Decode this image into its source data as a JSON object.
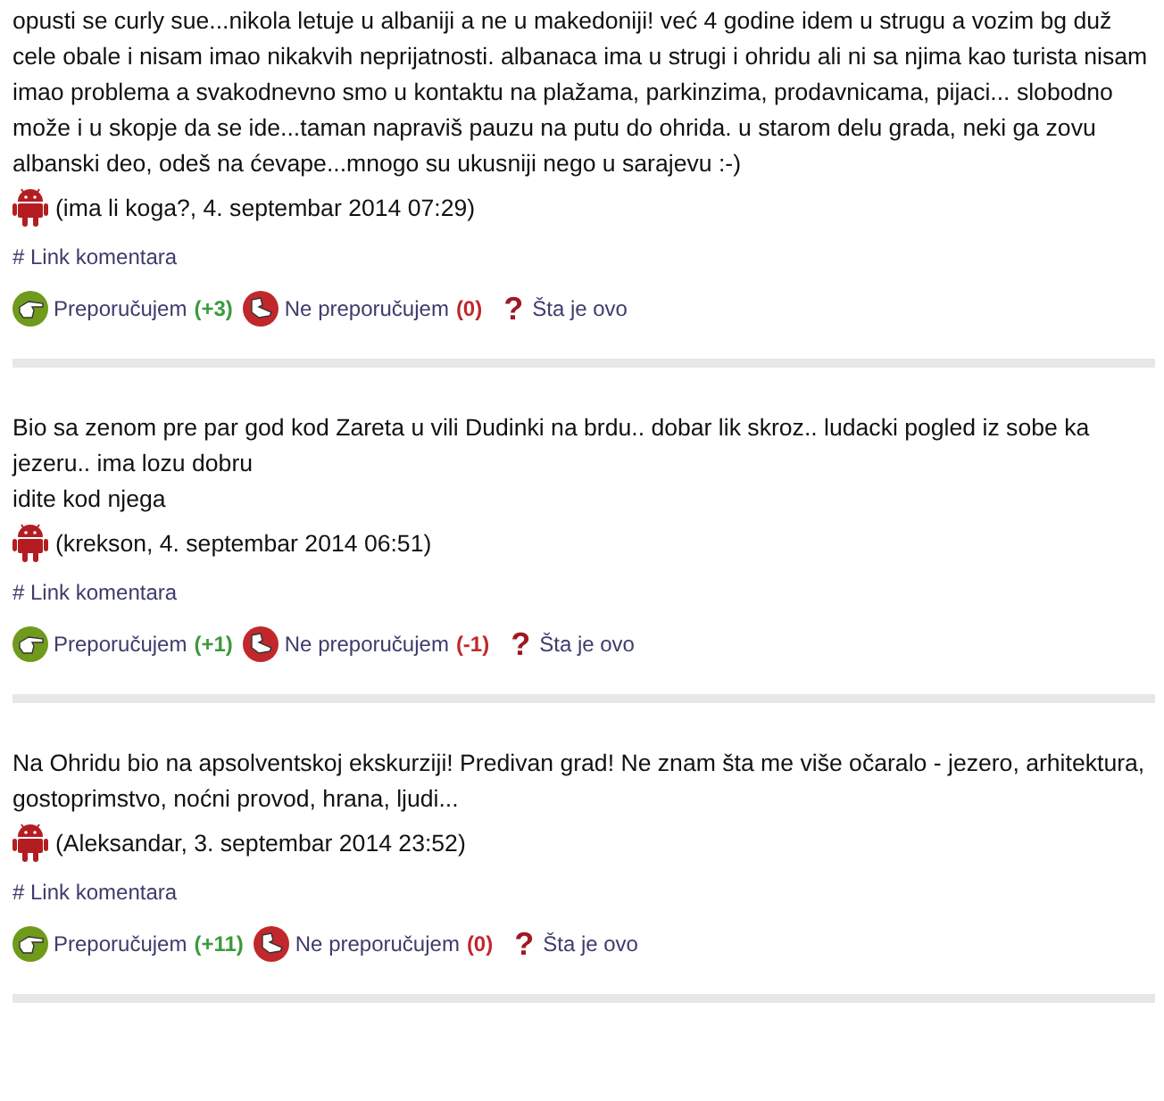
{
  "comments": [
    {
      "lines": [
        "opusti se curly sue...nikola letuje u albaniji a ne u makedoniji! već 4 godine idem u strugu a vozim bg duž cele obale i nisam imao nikakvih neprijatnosti. albanaca ima u strugi i ohridu ali ni sa njima kao turista nisam imao problema a svakodnevno smo u kontaktu na plažama, parkinzima, prodavnicama, pijaci... slobodno može i u skopje da se ide...taman napraviš pauzu na putu do ohrida. u starom delu grada, neki ga zovu albanski deo, odeš na ćevape...mnogo su ukusniji nego u sarajevu :-)"
      ],
      "meta": "(ima li koga?, 4. septembar 2014 07:29)",
      "link": "# Link komentara",
      "up_label": "Preporučujem",
      "up_count": "(+3)",
      "down_label": "Ne preporučujem",
      "down_count": "(0)",
      "help_mark": "?",
      "help_label": "Šta je ovo"
    },
    {
      "lines": [
        "Bio sa zenom pre par god kod Zareta u vili Dudinki na brdu.. dobar lik skroz.. ludacki pogled iz sobe ka jezeru.. ima lozu dobru",
        "idite kod njega"
      ],
      "meta": "(krekson, 4. septembar 2014 06:51)",
      "link": "# Link komentara",
      "up_label": "Preporučujem",
      "up_count": "(+1)",
      "down_label": "Ne preporučujem",
      "down_count": "(-1)",
      "help_mark": "?",
      "help_label": "Šta je ovo"
    },
    {
      "lines": [
        "Na Ohridu bio na apsolventskoj ekskurziji! Predivan grad! Ne znam šta me više očaralo - jezero, arhitektura, gostoprimstvo, noćni provod, hrana, ljudi..."
      ],
      "meta": "(Aleksandar, 3. septembar 2014 23:52)",
      "link": "# Link komentara",
      "up_label": "Preporučujem",
      "up_count": "(+11)",
      "down_label": "Ne preporučujem",
      "down_count": "(0)",
      "help_mark": "?",
      "help_label": "Šta je ovo"
    }
  ]
}
